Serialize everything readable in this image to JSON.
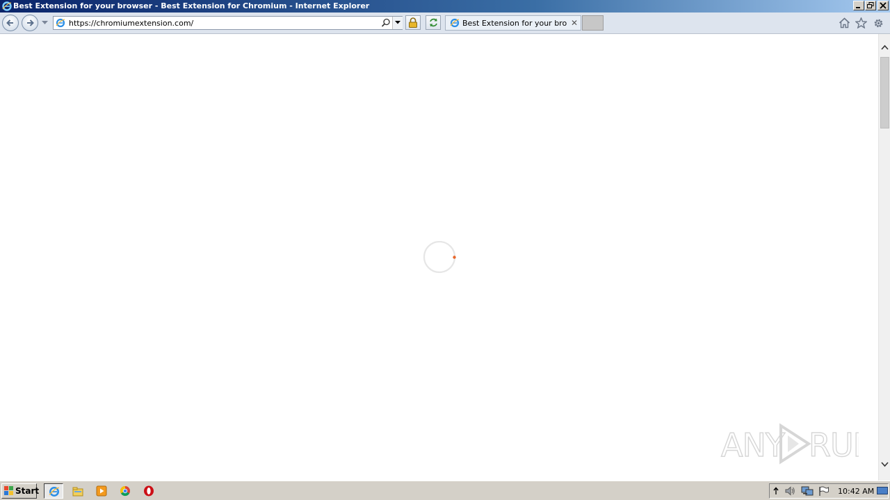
{
  "window": {
    "title": "Best Extension for your browser - Best Extension for Chromium - Internet Explorer",
    "controls": [
      "minimize-icon",
      "restore-icon",
      "close-icon"
    ]
  },
  "navbar": {
    "address": "https://chromiumextension.com/",
    "tab_label": "Best Extension for your bro...",
    "tab_close": "✕",
    "icons": [
      "back-icon",
      "forward-icon",
      "search-icon",
      "lock-icon",
      "refresh-icon",
      "home-icon",
      "favorites-star-icon",
      "gear-icon"
    ]
  },
  "content": {
    "loading": true,
    "watermark": "ANY RUN"
  },
  "taskbar": {
    "start_label": "Start",
    "apps": [
      "internet-explorer-icon",
      "file-explorer-icon",
      "media-player-icon",
      "chrome-icon",
      "opera-icon"
    ],
    "tray_icons": [
      "show-hidden-icon",
      "volume-icon",
      "network-icon",
      "flag-icon"
    ],
    "clock": "10:42 AM"
  },
  "colors": {
    "titlebar": "#0a246a",
    "spinner_accent": "#e8662a",
    "taskbar": "#d4d0c8"
  }
}
